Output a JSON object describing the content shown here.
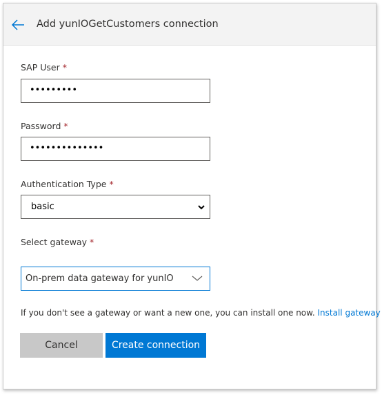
{
  "header": {
    "title": "Add yunIOGetCustomers connection",
    "back_icon": "arrow-left-icon"
  },
  "form": {
    "sap_user": {
      "label": "SAP User",
      "required_mark": "*",
      "value": "•••••••••"
    },
    "password": {
      "label": "Password",
      "required_mark": "*",
      "value": "••••••••••••••"
    },
    "auth_type": {
      "label": "Authentication Type",
      "required_mark": "*",
      "value": "basic"
    },
    "gateway": {
      "label": "Select gateway",
      "required_mark": "*",
      "value": "On-prem data gateway for yunIO"
    }
  },
  "hint": {
    "text": "If you don't see a gateway or want a new one, you can install one now.",
    "link": "Install gateway"
  },
  "buttons": {
    "cancel": "Cancel",
    "create": "Create connection"
  },
  "colors": {
    "accent": "#0078d4",
    "required": "#a4262c",
    "header_bg": "#f3f3f3"
  }
}
